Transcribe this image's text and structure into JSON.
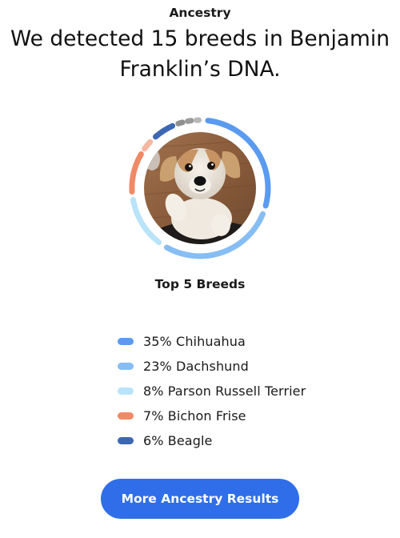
{
  "header": {
    "section_label": "Ancestry",
    "headline": "We detected 15 breeds in Benjamin Franklin’s DNA."
  },
  "ring": {
    "photo_subject": "dog-photo",
    "segments_colors": [
      "#5a9bef",
      "#86bdf3",
      "#b9e3f8",
      "#f08a66",
      "#3e67b3",
      "#909090",
      "#b3b3b3"
    ]
  },
  "top_breeds": {
    "title": "Top 5 Breeds",
    "items": [
      {
        "label": "35% Chihuahua",
        "color": "#5a9bef"
      },
      {
        "label": "23% Dachshund",
        "color": "#86bdf3"
      },
      {
        "label": "8% Parson Russell Terrier",
        "color": "#b9e3f8"
      },
      {
        "label": "7% Bichon Frise",
        "color": "#f08a66"
      },
      {
        "label": "6% Beagle",
        "color": "#3e67b3"
      }
    ]
  },
  "cta": {
    "label": "More Ancestry Results"
  }
}
